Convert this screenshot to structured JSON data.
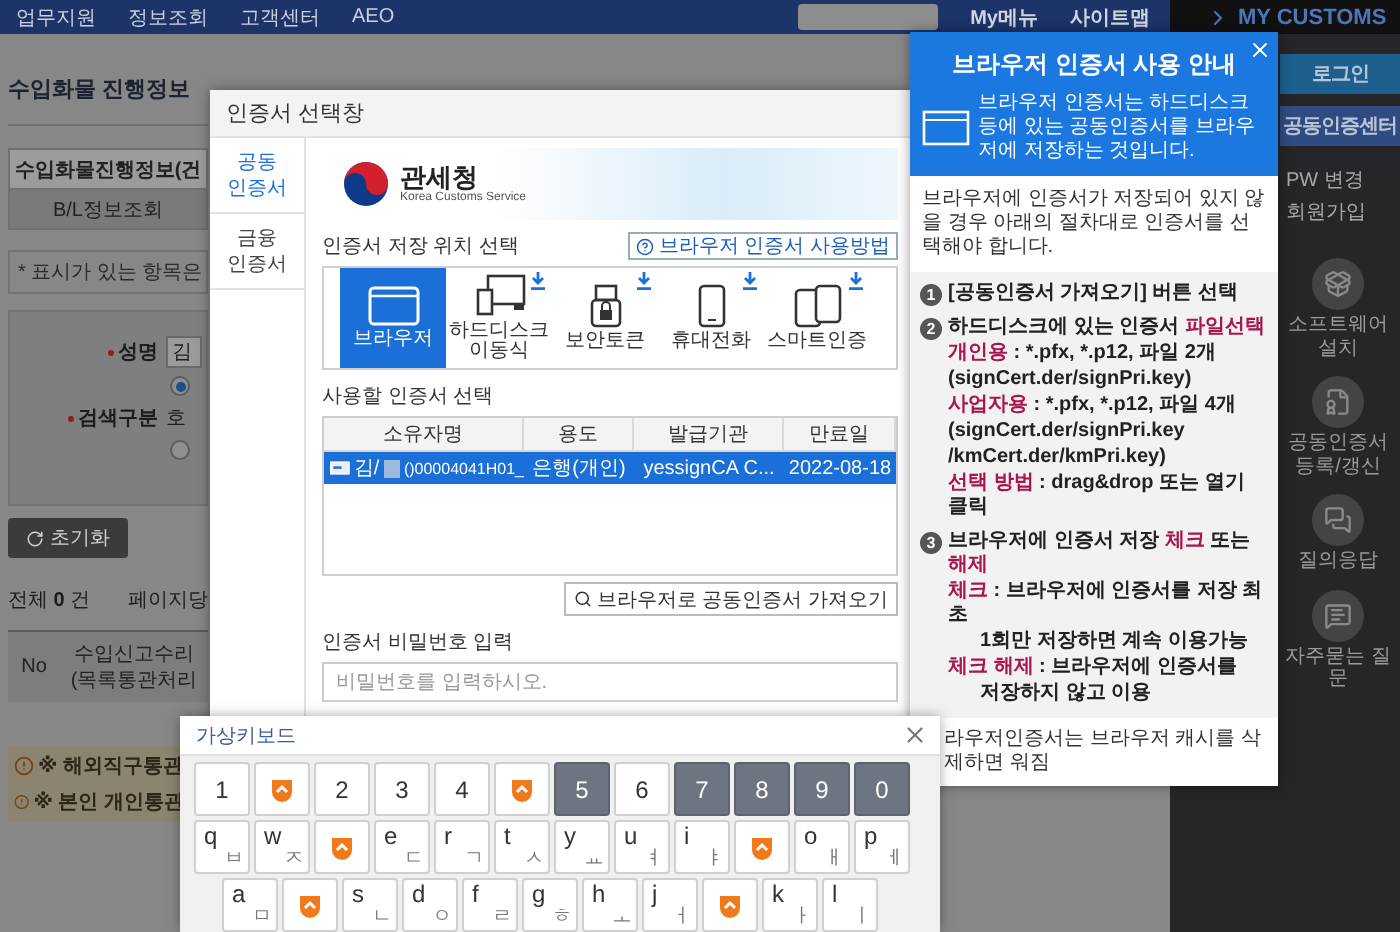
{
  "top_nav": {
    "items": [
      "업무지원",
      "정보조회",
      "고객센터",
      "AEO"
    ],
    "my_menu": "My메뉴",
    "sitemap": "사이트맵"
  },
  "sidebar": {
    "title": "MY CUSTOMS",
    "login": "로그인",
    "cert_center": "공동인증센터",
    "links": [
      "PW 변경",
      "회원가입"
    ],
    "shortcuts": [
      {
        "kind": "software",
        "label": "소프트웨어 설치"
      },
      {
        "kind": "certificate",
        "label": "공동인증서 등록/갱신"
      },
      {
        "kind": "qna",
        "label": "질의응답"
      },
      {
        "kind": "faq",
        "label": "자주묻는 질문"
      }
    ]
  },
  "page": {
    "title": "수입화물 진행정보",
    "tabs": [
      {
        "label": "수입화물진행정보(건",
        "selected": true
      },
      {
        "label": "B/L정보조회",
        "selected": false
      }
    ],
    "required_note": "* 표시가 있는 항목은",
    "name_label": "성명",
    "name_value": "김",
    "search_label": "검색구분",
    "search_option": "호",
    "radios": [
      {
        "selected": true
      },
      {
        "selected": false
      }
    ],
    "reset_button": "초기화",
    "total": "전체 **0** 건",
    "per_page": "페이지당",
    "table_columns": [
      {
        "lines": [
          "No"
        ]
      },
      {
        "lines": [
          "수입신고수리",
          "(목록통관처리"
        ]
      }
    ],
    "notices": [
      "※ 해외직구통관",
      "※ 본인 개인통관"
    ]
  },
  "cert_dialog": {
    "title": "인증서 선택창",
    "tabs": [
      {
        "label": "공동 인증서",
        "selected": true
      },
      {
        "label": "금융 인증서",
        "selected": false
      }
    ],
    "banner": {
      "name": "관세청",
      "subtitle": "Korea Customs Service"
    },
    "storage_label": "인증서 저장 위치 선택",
    "help_button": "브라우저 인증서 사용방법",
    "storage_options": [
      {
        "kind": "browser",
        "label": "브라우저",
        "selected": true,
        "download": false
      },
      {
        "kind": "disk",
        "label": "하드디스크 이동식",
        "selected": false,
        "download": true
      },
      {
        "kind": "token",
        "label": "보안토큰",
        "selected": false,
        "download": true
      },
      {
        "kind": "phone",
        "label": "휴대전화",
        "selected": false,
        "download": true
      },
      {
        "kind": "smart",
        "label": "스마트인증",
        "selected": false,
        "download": true
      }
    ],
    "list_label": "사용할 인증서 선택",
    "columns": [
      "소유자명",
      "용도",
      "발급기관",
      "만료일"
    ],
    "rows": [
      {
        "owner": "김/",
        "owner_rest": "()00004041H01_",
        "usage": "은행(개인)",
        "issuer": "yessignCA C...",
        "expires": "2022-08-18",
        "selected": true
      }
    ],
    "import_button": "브라우저로 공동인증서 가져오기",
    "password_label": "인증서 비밀번호 입력",
    "password_placeholder": "비밀번호를 입력하시오."
  },
  "guide": {
    "title": "브라우저 인증서 사용 안내",
    "intro": "브라우저 인증서는 하드디스크 등에 있는 공동인증서를 브라우저에 저장하는 것입니다.",
    "lead": "브라우저에 인증서가 저장되어 있지 않을 경우 아래의 절차대로 인증서를 선택해야 합니다.",
    "steps": [
      {
        "number": "1",
        "lines": [
          {
            "indent": false,
            "segments": [
              {
                "text": "[공동인증서 가져오기] 버튼 선택",
                "highlight": false
              }
            ]
          }
        ]
      },
      {
        "number": "2",
        "lines": [
          {
            "indent": false,
            "segments": [
              {
                "text": "하드디스크에 있는 인증서 ",
                "highlight": false
              },
              {
                "text": "파일선택",
                "highlight": true
              }
            ]
          },
          {
            "indent": false,
            "segments": [
              {
                "text": "개인용",
                "highlight": true
              },
              {
                "text": " : *.pfx, *.p12, 파일 2개",
                "highlight": false
              }
            ]
          },
          {
            "indent": false,
            "segments": [
              {
                "text": "(signCert.der/signPri.key)",
                "highlight": false
              }
            ]
          },
          {
            "indent": false,
            "segments": [
              {
                "text": "사업자용",
                "highlight": true
              },
              {
                "text": " : *.pfx, *.p12, 파일 4개",
                "highlight": false
              }
            ]
          },
          {
            "indent": false,
            "segments": [
              {
                "text": "(signCert.der/signPri.key",
                "highlight": false
              }
            ]
          },
          {
            "indent": false,
            "segments": [
              {
                "text": "/kmCert.der/kmPri.key)",
                "highlight": false
              }
            ]
          },
          {
            "indent": false,
            "segments": [
              {
                "text": "선택 방법",
                "highlight": true
              },
              {
                "text": " : drag&drop 또는 열기 클릭",
                "highlight": false
              }
            ]
          }
        ]
      },
      {
        "number": "3",
        "lines": [
          {
            "indent": false,
            "segments": [
              {
                "text": "브라우저에 인증서 저장 ",
                "highlight": false
              },
              {
                "text": "체크",
                "highlight": true
              },
              {
                "text": " 또는 ",
                "highlight": false
              },
              {
                "text": "해제",
                "highlight": true
              }
            ]
          },
          {
            "indent": false,
            "segments": [
              {
                "text": "체크",
                "highlight": true
              },
              {
                "text": " : 브라우저에 인증서를 저장 최초",
                "highlight": false
              }
            ]
          },
          {
            "indent": true,
            "segments": [
              {
                "text": "1회만 저장하면 계속 이용가능",
                "highlight": false
              }
            ]
          },
          {
            "indent": false,
            "segments": [
              {
                "text": "체크 해제",
                "highlight": true
              },
              {
                "text": " : 브라우저에 인증서를",
                "highlight": false
              }
            ]
          },
          {
            "indent": true,
            "segments": [
              {
                "text": "저장하지 않고 이용",
                "highlight": false
              }
            ]
          }
        ]
      }
    ],
    "footer": "라우저인증서는 브라우저 캐시를 삭제하면 워짐"
  },
  "keyboard": {
    "title": "가상키보드",
    "rows": [
      [
        {
          "kind": "char",
          "label": "1",
          "shaded": false
        },
        {
          "kind": "logo"
        },
        {
          "kind": "char",
          "label": "2",
          "shaded": false
        },
        {
          "kind": "char",
          "label": "3",
          "shaded": false
        },
        {
          "kind": "char",
          "label": "4",
          "shaded": false
        },
        {
          "kind": "logo"
        },
        {
          "kind": "char",
          "label": "5",
          "shaded": true
        },
        {
          "kind": "char",
          "label": "6",
          "shaded": false
        },
        {
          "kind": "char",
          "label": "7",
          "shaded": true
        },
        {
          "kind": "char",
          "label": "8",
          "shaded": true
        },
        {
          "kind": "char",
          "label": "9",
          "shaded": true
        },
        {
          "kind": "char",
          "label": "0",
          "shaded": true
        }
      ],
      [
        {
          "kind": "char",
          "label": "q",
          "sub": "ㅂ",
          "shaded": false
        },
        {
          "kind": "char",
          "label": "w",
          "sub": "ㅈ",
          "shaded": false
        },
        {
          "kind": "logo"
        },
        {
          "kind": "char",
          "label": "e",
          "sub": "ㄷ",
          "shaded": false
        },
        {
          "kind": "char",
          "label": "r",
          "sub": "ㄱ",
          "shaded": false
        },
        {
          "kind": "char",
          "label": "t",
          "sub": "ㅅ",
          "shaded": false
        },
        {
          "kind": "char",
          "label": "y",
          "sub": "ㅛ",
          "shaded": false
        },
        {
          "kind": "char",
          "label": "u",
          "sub": "ㅕ",
          "shaded": false
        },
        {
          "kind": "char",
          "label": "i",
          "sub": "ㅑ",
          "shaded": false
        },
        {
          "kind": "logo"
        },
        {
          "kind": "char",
          "label": "o",
          "sub": "ㅐ",
          "shaded": false
        },
        {
          "kind": "char",
          "label": "p",
          "sub": "ㅔ",
          "shaded": false
        }
      ],
      [
        {
          "kind": "char",
          "label": "a",
          "sub": "ㅁ",
          "shaded": false
        },
        {
          "kind": "logo"
        },
        {
          "kind": "char",
          "label": "s",
          "sub": "ㄴ",
          "shaded": false
        },
        {
          "kind": "char",
          "label": "d",
          "sub": "ㅇ",
          "shaded": false
        },
        {
          "kind": "char",
          "label": "f",
          "sub": "ㄹ",
          "shaded": false
        },
        {
          "kind": "char",
          "label": "g",
          "sub": "ㅎ",
          "shaded": false
        },
        {
          "kind": "char",
          "label": "h",
          "sub": "ㅗ",
          "shaded": false
        },
        {
          "kind": "char",
          "label": "j",
          "sub": "ㅓ",
          "shaded": false
        },
        {
          "kind": "logo"
        },
        {
          "kind": "char",
          "label": "k",
          "sub": "ㅏ",
          "shaded": false
        },
        {
          "kind": "char",
          "label": "l",
          "sub": "ㅣ",
          "shaded": false
        }
      ]
    ]
  }
}
